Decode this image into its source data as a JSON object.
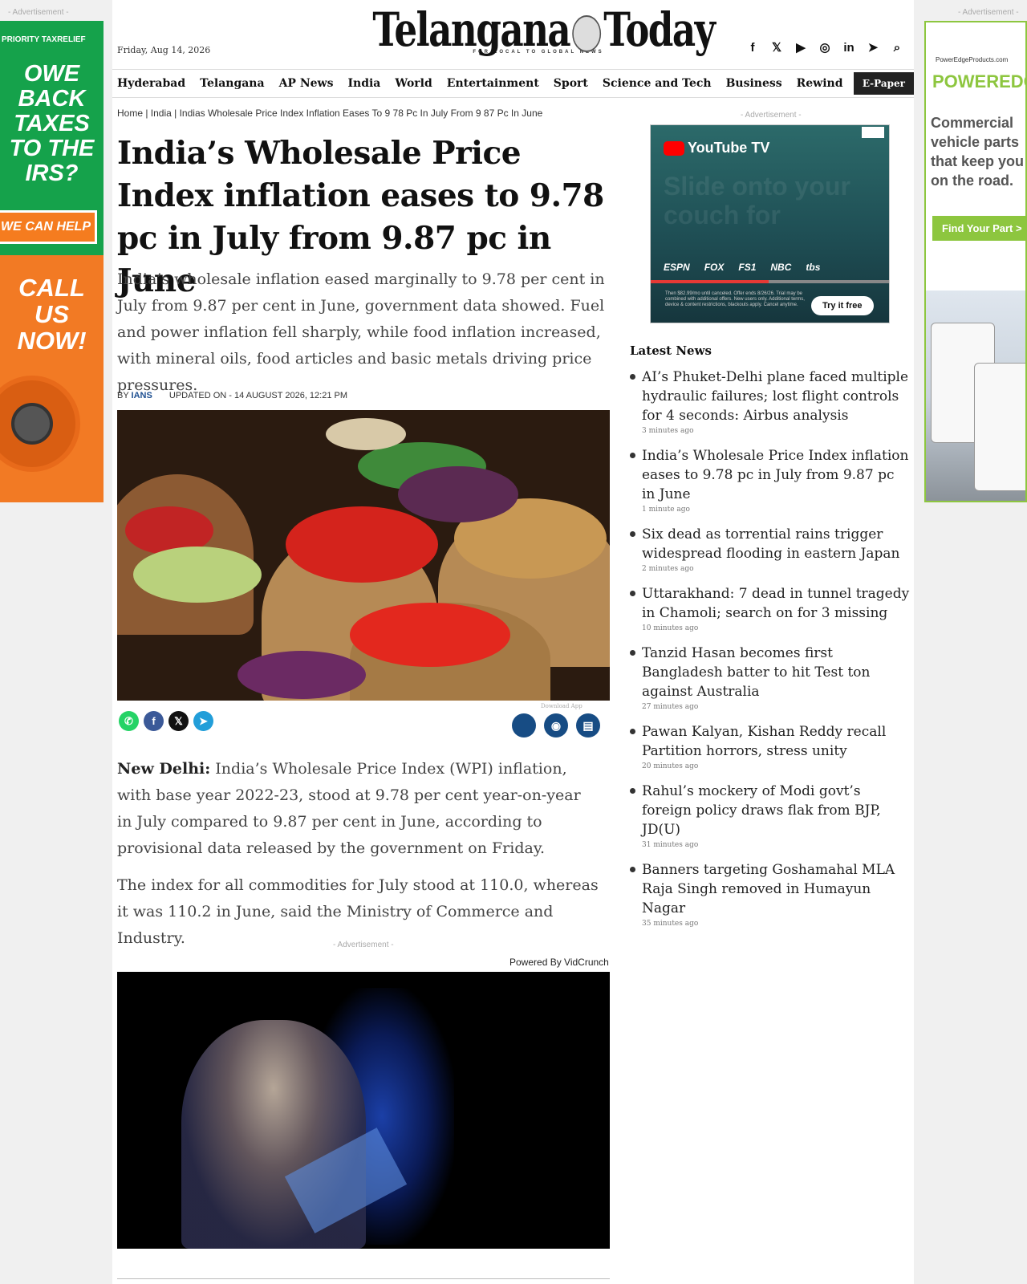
{
  "ads": {
    "label": "- Advertisement -",
    "left": {
      "brand": "PRIORITY TAXRELIEF",
      "headline": "OWE BACK TAXES TO THE IRS?",
      "help": "WE CAN HELP",
      "call": "CALL US NOW!"
    },
    "right": {
      "site": "PowerEdgeProducts.com",
      "logo": "POWEREDGE",
      "copy": "Commercial vehicle parts that keep you on the road.",
      "cta": "Find Your Part >"
    },
    "sidebar": {
      "brand": "YouTube TV",
      "ghost_text": "Slide onto your couch for",
      "networks": [
        "ESPN",
        "FOX",
        "FS1",
        "NBC",
        "tbs"
      ],
      "fine_print": "Then $82.99/mo until canceled. Offer ends 8/26/26. Trial may be combined with additional offers. New users only. Additional terms, device & content restrictions, blackouts apply. Cancel anytime.",
      "cta": "Try it free",
      "progress": 0.49
    }
  },
  "header": {
    "date": "Friday, Aug 14, 2026",
    "masthead_left": "Telangana",
    "masthead_right": "Today",
    "tagline": "FOR LOCAL TO GLOBAL NEWS",
    "social_icons": [
      "facebook-icon",
      "x-icon",
      "youtube-icon",
      "instagram-icon",
      "linkedin-icon",
      "telegram-icon",
      "search-icon"
    ]
  },
  "nav": {
    "items": [
      "Hyderabad",
      "Telangana",
      "AP News",
      "India",
      "World",
      "Entertainment",
      "Sport",
      "Science and Tech",
      "Business",
      "Rewind",
      "..."
    ],
    "epaper": "E-Paper"
  },
  "article": {
    "breadcrumb": "Home | India | Indias Wholesale Price Index Inflation Eases To 9 78 Pc In July From 9 87 Pc In June",
    "headline": "India’s Wholesale Price Index inflation eases to 9.78 pc in July from 9.87 pc in June",
    "summary": "India’s wholesale inflation eased marginally to 9.78 per cent in July from 9.87 per cent in June, government data showed. Fuel and power inflation fell sharply, while food inflation increased, with mineral oils, food articles and basic metals driving price pressures.",
    "by_label": "BY",
    "author": "IANS",
    "updated": "UPDATED ON - 14 AUGUST 2026, 12:21 PM",
    "download_app": "Download App",
    "dateline": "New Delhi:",
    "para1": " India’s Wholesale Price Index (WPI) inflation, with base year 2022-23, stood at 9.78 per cent year-on-year in July compared to 9.87 per cent in June, according to provisional data released by the government on Friday.",
    "para2": "The index for all commodities for July stood at 110.0, whereas it was 110.2 in June, said the Ministry of Commerce and Industry.",
    "powered_by": "Powered By VidCrunch"
  },
  "sidebar": {
    "latest_title": "Latest News",
    "news": [
      {
        "headline": "AI’s Phuket-Delhi plane faced multiple hydraulic failures; lost flight controls for 4 seconds: Airbus analysis",
        "time": "3 minutes ago"
      },
      {
        "headline": "India’s Wholesale Price Index inflation eases to 9.78 pc in July from 9.87 pc in June",
        "time": "1 minute ago"
      },
      {
        "headline": "Six dead as torrential rains trigger widespread flooding in eastern Japan",
        "time": "2 minutes ago"
      },
      {
        "headline": "Uttarakhand: 7 dead in tunnel tragedy in Chamoli; search on for 3 missing",
        "time": "10 minutes ago"
      },
      {
        "headline": "Tanzid Hasan becomes first Bangladesh batter to hit Test ton against Australia",
        "time": "27 minutes ago"
      },
      {
        "headline": "Pawan Kalyan, Kishan Reddy recall Partition horrors, stress unity",
        "time": "20 minutes ago"
      },
      {
        "headline": "Rahul’s mockery of Modi govt’s foreign policy draws flak from BJP, JD(U)",
        "time": "31 minutes ago"
      },
      {
        "headline": "Banners targeting Goshamahal MLA Raja Singh removed in Humayun Nagar",
        "time": "35 minutes ago"
      }
    ]
  }
}
